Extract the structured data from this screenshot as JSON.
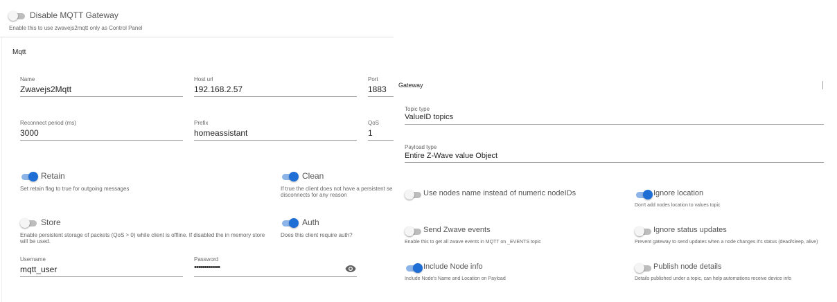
{
  "gateway_toggle": {
    "label": "Disable MQTT Gateway",
    "hint": "Enable this to use zwavejs2mqtt only as Control Panel",
    "on": false
  },
  "mqtt": {
    "title": "Mqtt",
    "name": {
      "label": "Name",
      "value": "Zwavejs2Mqtt"
    },
    "host": {
      "label": "Host url",
      "value": "192.168.2.57"
    },
    "port": {
      "label": "Port",
      "value": "1883"
    },
    "reconnect": {
      "label": "Reconnect period (ms)",
      "value": "3000"
    },
    "prefix": {
      "label": "Prefix",
      "value": "homeassistant"
    },
    "qos": {
      "label": "QoS",
      "value": "1"
    },
    "retain": {
      "label": "Retain",
      "hint": "Set retain flag to true for outgoing messages",
      "on": true
    },
    "clean": {
      "label": "Clean",
      "hint_line1": "If true the client does not have a persistent se",
      "hint_line2": "disconnects for any reason",
      "on": true
    },
    "store": {
      "label": "Store",
      "hint_line1": "Enable persistent storage of packets (QoS > 0) while client is offline. If disabled the in memory store",
      "hint_line2": "will be used.",
      "on": false
    },
    "auth": {
      "label": "Auth",
      "hint": "Does this client require auth?",
      "on": true
    },
    "username": {
      "label": "Username",
      "value": "mqtt_user"
    },
    "password": {
      "label": "Password",
      "value": "•••••••••••••"
    }
  },
  "gateway": {
    "title": "Gateway",
    "topic_type": {
      "label": "Topic type",
      "value": "ValueID topics"
    },
    "payload_type": {
      "label": "Payload type",
      "value": "Entire Z-Wave value Object"
    },
    "use_nodes_name": {
      "label": "Use nodes name instead of numeric nodeIDs",
      "on": false
    },
    "ignore_location": {
      "label": "Ignore location",
      "hint": "Don't add nodes location to values topic",
      "on": true
    },
    "send_events": {
      "label": "Send Zwave events",
      "hint": "Enable this to get all zwave events in MQTT on _EVENTS topic",
      "on": false
    },
    "ignore_status": {
      "label": "Ignore status updates",
      "hint": "Prevent gateway to send updates when a node changes it's status (dead/sleep, alive)",
      "on": false
    },
    "include_node_info": {
      "label": "Include Node info",
      "hint": "Include Node's Name and Location on Payload",
      "on": true
    },
    "publish_node_details": {
      "label": "Publish node details",
      "hint": "Details published under a topic, can help automations receive device info",
      "on": false
    }
  }
}
